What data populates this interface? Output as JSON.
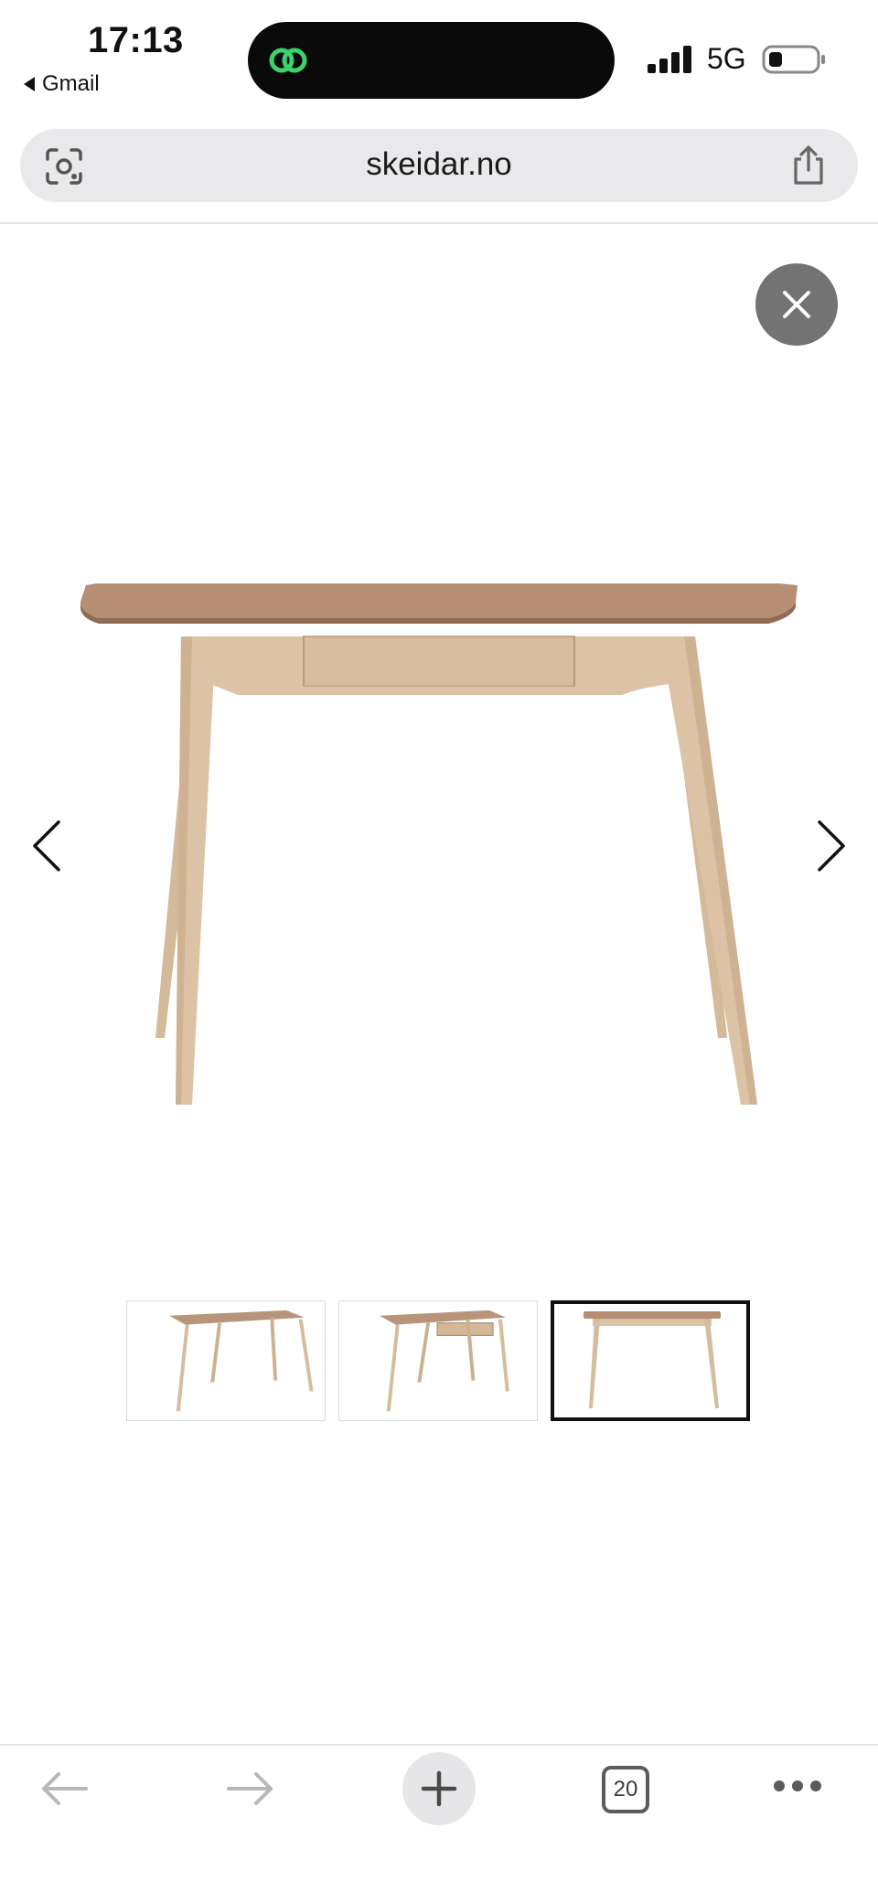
{
  "status_bar": {
    "time": "17:13",
    "back_app": "Gmail",
    "network": "5G"
  },
  "browser": {
    "url": "skeidar.no",
    "tab_count": "20"
  },
  "gallery": {
    "thumbnail_count": 3,
    "selected_thumbnail": 3
  },
  "colors": {
    "close_button_bg": "#737373",
    "selected_thumb_border": "#111111",
    "wood_top": "#b58e73",
    "wood_legs": "#dcc3a6",
    "island_accent": "#3bd36b"
  },
  "icons": [
    "lens-icon",
    "share-icon",
    "close-icon",
    "chevron-left-icon",
    "chevron-right-icon",
    "back-arrow-icon",
    "forward-arrow-icon",
    "plus-icon",
    "more-icon"
  ]
}
